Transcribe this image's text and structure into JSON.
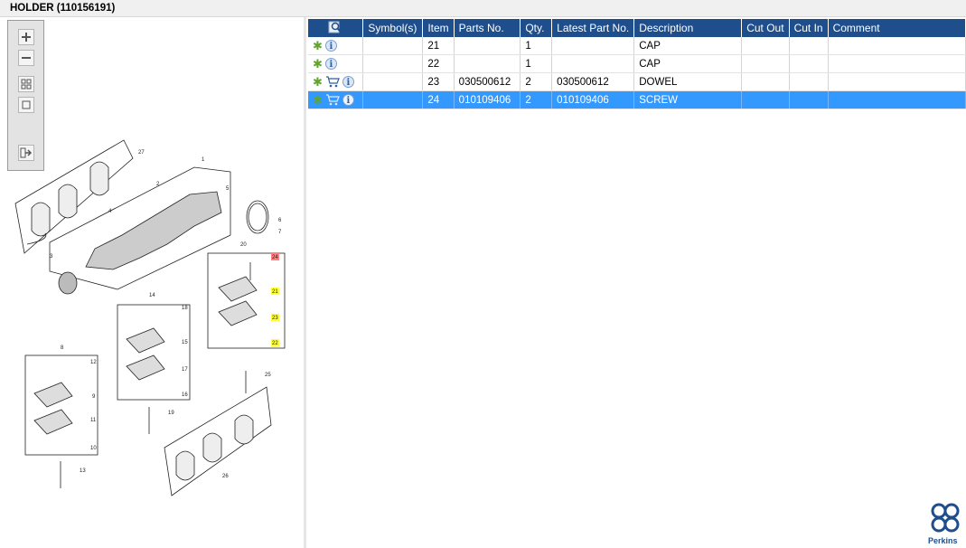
{
  "window": {
    "title": "HOLDER (110156191)"
  },
  "toolbox": {
    "buttons": [
      "zoom-in",
      "zoom-out",
      "fit-page",
      "actual-size",
      "export"
    ]
  },
  "diagram": {
    "callouts": [
      "27",
      "1",
      "2",
      "5",
      "6",
      "7",
      "4",
      "3",
      "20",
      "24",
      "21",
      "23",
      "22",
      "25",
      "14",
      "18",
      "15",
      "17",
      "16",
      "8",
      "12",
      "9",
      "11",
      "10",
      "19",
      "13",
      "26"
    ],
    "highlight_colors": {
      "selected": "#ff7f7f",
      "related": "#ffff33"
    }
  },
  "grid": {
    "columns": [
      "Symbol(s)",
      "Item",
      "Parts No.",
      "Qty.",
      "Latest Part No.",
      "Description",
      "Cut Out",
      "Cut In",
      "Comment"
    ],
    "rows": [
      {
        "icons": [
          "gear-icon",
          "info-icon"
        ],
        "symbols": "",
        "item": "21",
        "parts_no": "",
        "qty": "1",
        "latest_part_no": "",
        "description": "CAP",
        "cut_out": "",
        "cut_in": "",
        "comment": ""
      },
      {
        "icons": [
          "gear-icon",
          "info-icon"
        ],
        "symbols": "",
        "item": "22",
        "parts_no": "",
        "qty": "1",
        "latest_part_no": "",
        "description": "CAP",
        "cut_out": "",
        "cut_in": "",
        "comment": ""
      },
      {
        "icons": [
          "gear-icon",
          "cart-icon",
          "info-icon"
        ],
        "symbols": "",
        "item": "23",
        "parts_no": "030500612",
        "qty": "2",
        "latest_part_no": "030500612",
        "description": "DOWEL",
        "cut_out": "",
        "cut_in": "",
        "comment": ""
      },
      {
        "icons": [
          "gear-icon",
          "cart-icon",
          "info-icon"
        ],
        "symbols": "",
        "item": "24",
        "parts_no": "010109406",
        "qty": "2",
        "latest_part_no": "010109406",
        "description": "SCREW",
        "cut_out": "",
        "cut_in": "",
        "comment": "",
        "selected": true
      }
    ]
  },
  "brand": {
    "name": "Perkins",
    "color": "#1f4e8c"
  },
  "colors": {
    "header": "#1f4e8c",
    "selection": "#3399ff",
    "gear": "#5fa62a"
  }
}
